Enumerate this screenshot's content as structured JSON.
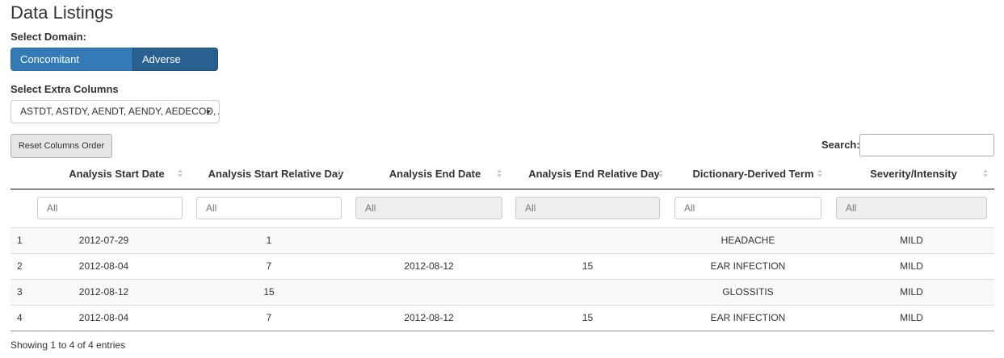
{
  "page": {
    "title": "Data Listings"
  },
  "domain": {
    "label": "Select Domain:",
    "options": [
      "Concomitant Medication",
      "Adverse Events"
    ],
    "selected": "Adverse Events"
  },
  "extra_columns": {
    "label": "Select Extra Columns",
    "value": "ASTDT, ASTDY, AENDT, AENDY, AEDECOD, AESEV"
  },
  "toolbar": {
    "reset_label": "Reset Columns Order"
  },
  "search": {
    "label": "Search:",
    "value": ""
  },
  "table": {
    "columns": [
      "Analysis Start Date",
      "Analysis Start Relative Day",
      "Analysis End Date",
      "Analysis End Relative Day",
      "Dictionary-Derived Term",
      "Severity/Intensity"
    ],
    "filters": [
      {
        "placeholder": "All",
        "disabled": false
      },
      {
        "placeholder": "All",
        "disabled": false
      },
      {
        "placeholder": "All",
        "disabled": true
      },
      {
        "placeholder": "All",
        "disabled": true
      },
      {
        "placeholder": "All",
        "disabled": false
      },
      {
        "placeholder": "All",
        "disabled": true
      }
    ],
    "rows": [
      [
        "1",
        "2012-07-29",
        "1",
        "",
        "",
        "HEADACHE",
        "MILD"
      ],
      [
        "2",
        "2012-08-04",
        "7",
        "2012-08-12",
        "15",
        "EAR INFECTION",
        "MILD"
      ],
      [
        "3",
        "2012-08-12",
        "15",
        "",
        "",
        "GLOSSITIS",
        "MILD"
      ],
      [
        "4",
        "2012-08-04",
        "7",
        "2012-08-12",
        "15",
        "EAR INFECTION",
        "MILD"
      ]
    ],
    "info": "Showing 1 to 4 of 4 entries"
  }
}
